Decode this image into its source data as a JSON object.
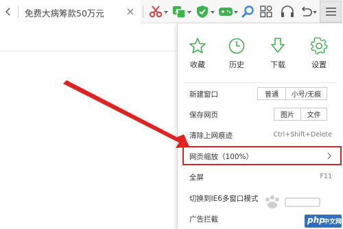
{
  "toolbar": {
    "search_text": "免费大病筹款50万元",
    "icons": [
      "chevron-left-icon",
      "close-icon",
      "scissors-icon",
      "translate-icon",
      "shield-icon",
      "gamepad-icon",
      "search-icon",
      "apps-grid-icon",
      "headphones-icon",
      "undo-icon",
      "menu-icon"
    ],
    "colors": {
      "scissors": "#e23d3d",
      "green": "#3cb34a",
      "search": "#3b8ad9"
    }
  },
  "menu": {
    "quick_actions": [
      {
        "label": "收藏",
        "icon": "star-icon"
      },
      {
        "label": "历史",
        "icon": "clock-icon"
      },
      {
        "label": "下载",
        "icon": "download-icon"
      },
      {
        "label": "设置",
        "icon": "gear-icon"
      }
    ],
    "accent_color": "#3cb34a",
    "items": {
      "new_window": {
        "label": "新建窗口",
        "options": [
          "普通",
          "小号/无痕"
        ]
      },
      "save_page": {
        "label": "保存网页",
        "options": [
          "图片",
          "文件"
        ]
      },
      "clear_history": {
        "label": "清除上网痕迹",
        "shortcut": "Ctrl+Shift+Delete"
      },
      "zoom": {
        "label": "网页缩放（100%）"
      },
      "fullscreen": {
        "label": "全屏",
        "shortcut": "F11"
      },
      "ie6_mode": {
        "label": "切换到IE6多窗口模式"
      },
      "ad_block": {
        "label": "广告拦截"
      }
    }
  },
  "annotation": {
    "color": "#e0231e"
  },
  "watermarks": {
    "php_text_a": "php",
    "php_text_b": "中文网"
  }
}
